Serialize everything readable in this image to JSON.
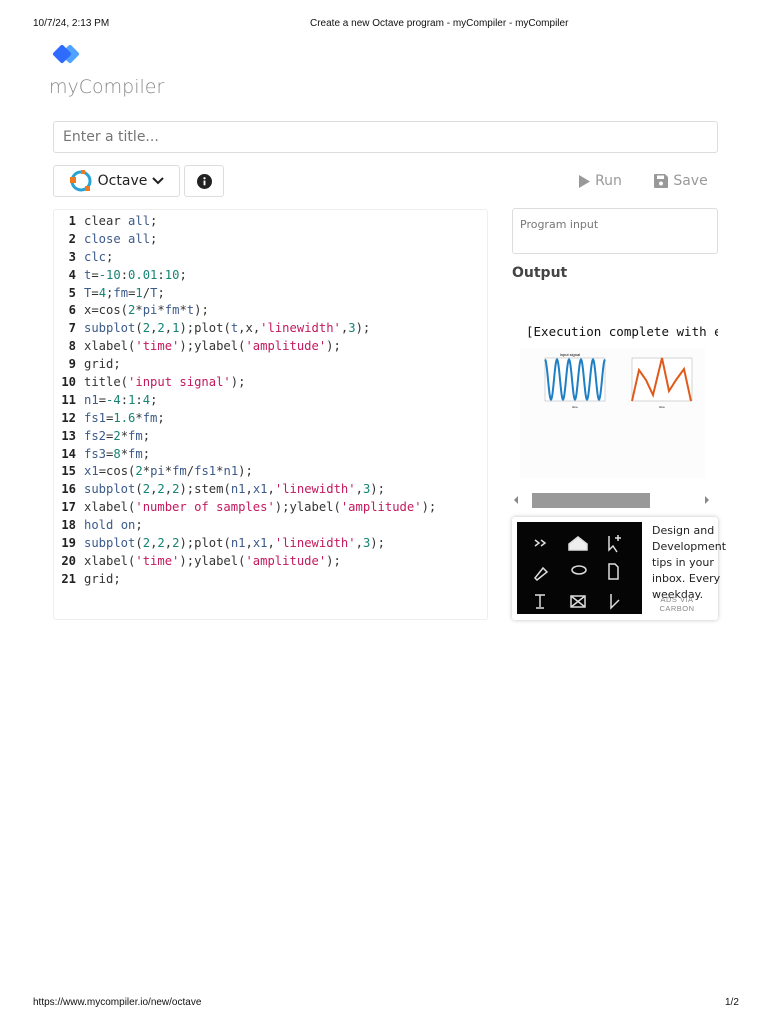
{
  "print_header": {
    "datetime": "10/7/24, 2:13 PM",
    "page_title": "Create a new Octave program - myCompiler - myCompiler"
  },
  "print_footer": {
    "url": "https://www.mycompiler.io/new/octave",
    "page": "1/2"
  },
  "brand": {
    "name": "myCompiler",
    "color": "#2f6bff"
  },
  "title_input": {
    "placeholder": "Enter a title..."
  },
  "toolbar": {
    "language": "Octave",
    "run": "Run",
    "save": "Save"
  },
  "editor": {
    "lines": [
      [
        [
          "clear ",
          "d"
        ],
        [
          "all",
          "k"
        ],
        [
          ";",
          "d"
        ]
      ],
      [
        [
          "close ",
          "k"
        ],
        [
          "all",
          "k"
        ],
        [
          ";",
          "d"
        ]
      ],
      [
        [
          "clc",
          "k"
        ],
        [
          ";",
          "d"
        ]
      ],
      [
        [
          "t",
          "k"
        ],
        [
          "=",
          "d"
        ],
        [
          "-10",
          "n"
        ],
        [
          ":",
          "d"
        ],
        [
          "0.01",
          "n"
        ],
        [
          ":",
          "d"
        ],
        [
          "10",
          "n"
        ],
        [
          ";",
          "d"
        ]
      ],
      [
        [
          "T",
          "k"
        ],
        [
          "=",
          "d"
        ],
        [
          "4",
          "n"
        ],
        [
          ";",
          "d"
        ],
        [
          "fm",
          "k"
        ],
        [
          "=",
          "d"
        ],
        [
          "1",
          "n"
        ],
        [
          "/",
          "d"
        ],
        [
          "T",
          "k"
        ],
        [
          ";",
          "d"
        ]
      ],
      [
        [
          "x=cos(",
          "d"
        ],
        [
          "2",
          "n"
        ],
        [
          "*",
          "d"
        ],
        [
          "pi",
          "k"
        ],
        [
          "*",
          "d"
        ],
        [
          "fm",
          "k"
        ],
        [
          "*",
          "d"
        ],
        [
          "t",
          "k"
        ],
        [
          ");",
          "d"
        ]
      ],
      [
        [
          "subplot",
          "k"
        ],
        [
          "(",
          "d"
        ],
        [
          "2",
          "n"
        ],
        [
          ",",
          "d"
        ],
        [
          "2",
          "n"
        ],
        [
          ",",
          "d"
        ],
        [
          "1",
          "n"
        ],
        [
          ");plot(",
          "d"
        ],
        [
          "t",
          "k"
        ],
        [
          ",x,",
          "d"
        ],
        [
          "'linewidth'",
          "s"
        ],
        [
          ",",
          "d"
        ],
        [
          "3",
          "n"
        ],
        [
          ");",
          "d"
        ]
      ],
      [
        [
          "xlabel(",
          "d"
        ],
        [
          "'time'",
          "s"
        ],
        [
          ");ylabel(",
          "d"
        ],
        [
          "'amplitude'",
          "s"
        ],
        [
          ");",
          "d"
        ]
      ],
      [
        [
          "grid;",
          "d"
        ]
      ],
      [
        [
          "title(",
          "d"
        ],
        [
          "'input signal'",
          "s"
        ],
        [
          ");",
          "d"
        ]
      ],
      [
        [
          "n1",
          "k"
        ],
        [
          "=",
          "d"
        ],
        [
          "-4",
          "n"
        ],
        [
          ":",
          "d"
        ],
        [
          "1",
          "n"
        ],
        [
          ":",
          "d"
        ],
        [
          "4",
          "n"
        ],
        [
          ";",
          "d"
        ]
      ],
      [
        [
          "fs1",
          "k"
        ],
        [
          "=",
          "d"
        ],
        [
          "1.6",
          "n"
        ],
        [
          "*",
          "d"
        ],
        [
          "fm",
          "k"
        ],
        [
          ";",
          "d"
        ]
      ],
      [
        [
          "fs2",
          "k"
        ],
        [
          "=",
          "d"
        ],
        [
          "2",
          "n"
        ],
        [
          "*",
          "d"
        ],
        [
          "fm",
          "k"
        ],
        [
          ";",
          "d"
        ]
      ],
      [
        [
          "fs3",
          "k"
        ],
        [
          "=",
          "d"
        ],
        [
          "8",
          "n"
        ],
        [
          "*",
          "d"
        ],
        [
          "fm",
          "k"
        ],
        [
          ";",
          "d"
        ]
      ],
      [
        [
          "x1",
          "k"
        ],
        [
          "=cos(",
          "d"
        ],
        [
          "2",
          "n"
        ],
        [
          "*",
          "d"
        ],
        [
          "pi",
          "k"
        ],
        [
          "*",
          "d"
        ],
        [
          "fm",
          "k"
        ],
        [
          "/",
          "d"
        ],
        [
          "fs1",
          "k"
        ],
        [
          "*",
          "d"
        ],
        [
          "n1",
          "k"
        ],
        [
          ");",
          "d"
        ]
      ],
      [
        [
          "subplot",
          "k"
        ],
        [
          "(",
          "d"
        ],
        [
          "2",
          "n"
        ],
        [
          ",",
          "d"
        ],
        [
          "2",
          "n"
        ],
        [
          ",",
          "d"
        ],
        [
          "2",
          "n"
        ],
        [
          ");stem(",
          "d"
        ],
        [
          "n1",
          "k"
        ],
        [
          ",",
          "d"
        ],
        [
          "x1",
          "k"
        ],
        [
          ",",
          "d"
        ],
        [
          "'linewidth'",
          "s"
        ],
        [
          ",",
          "d"
        ],
        [
          "3",
          "n"
        ],
        [
          ");",
          "d"
        ]
      ],
      [
        [
          "xlabel(",
          "d"
        ],
        [
          "'number of samples'",
          "s"
        ],
        [
          ");ylabel(",
          "d"
        ],
        [
          "'amplitude'",
          "s"
        ],
        [
          ");",
          "d"
        ]
      ],
      [
        [
          "hold ",
          "k"
        ],
        [
          "on",
          "k"
        ],
        [
          ";",
          "d"
        ]
      ],
      [
        [
          "subplot",
          "k"
        ],
        [
          "(",
          "d"
        ],
        [
          "2",
          "n"
        ],
        [
          ",",
          "d"
        ],
        [
          "2",
          "n"
        ],
        [
          ",",
          "d"
        ],
        [
          "2",
          "n"
        ],
        [
          ");plot(",
          "d"
        ],
        [
          "n1",
          "k"
        ],
        [
          ",",
          "d"
        ],
        [
          "x1",
          "k"
        ],
        [
          ",",
          "d"
        ],
        [
          "'linewidth'",
          "s"
        ],
        [
          ",",
          "d"
        ],
        [
          "3",
          "n"
        ],
        [
          ");",
          "d"
        ]
      ],
      [
        [
          "xlabel(",
          "d"
        ],
        [
          "'time'",
          "s"
        ],
        [
          ");ylabel(",
          "d"
        ],
        [
          "'amplitude'",
          "s"
        ],
        [
          ");",
          "d"
        ]
      ],
      [
        [
          "grid;",
          "d"
        ]
      ]
    ]
  },
  "program_input": {
    "placeholder": "Program input"
  },
  "output": {
    "heading": "Output",
    "text": "[Execution complete with e",
    "plot_title": "input signal"
  },
  "ad": {
    "text": "Design and Development tips in your inbox. Every weekday.",
    "via": "ADS VIA CARBON"
  }
}
